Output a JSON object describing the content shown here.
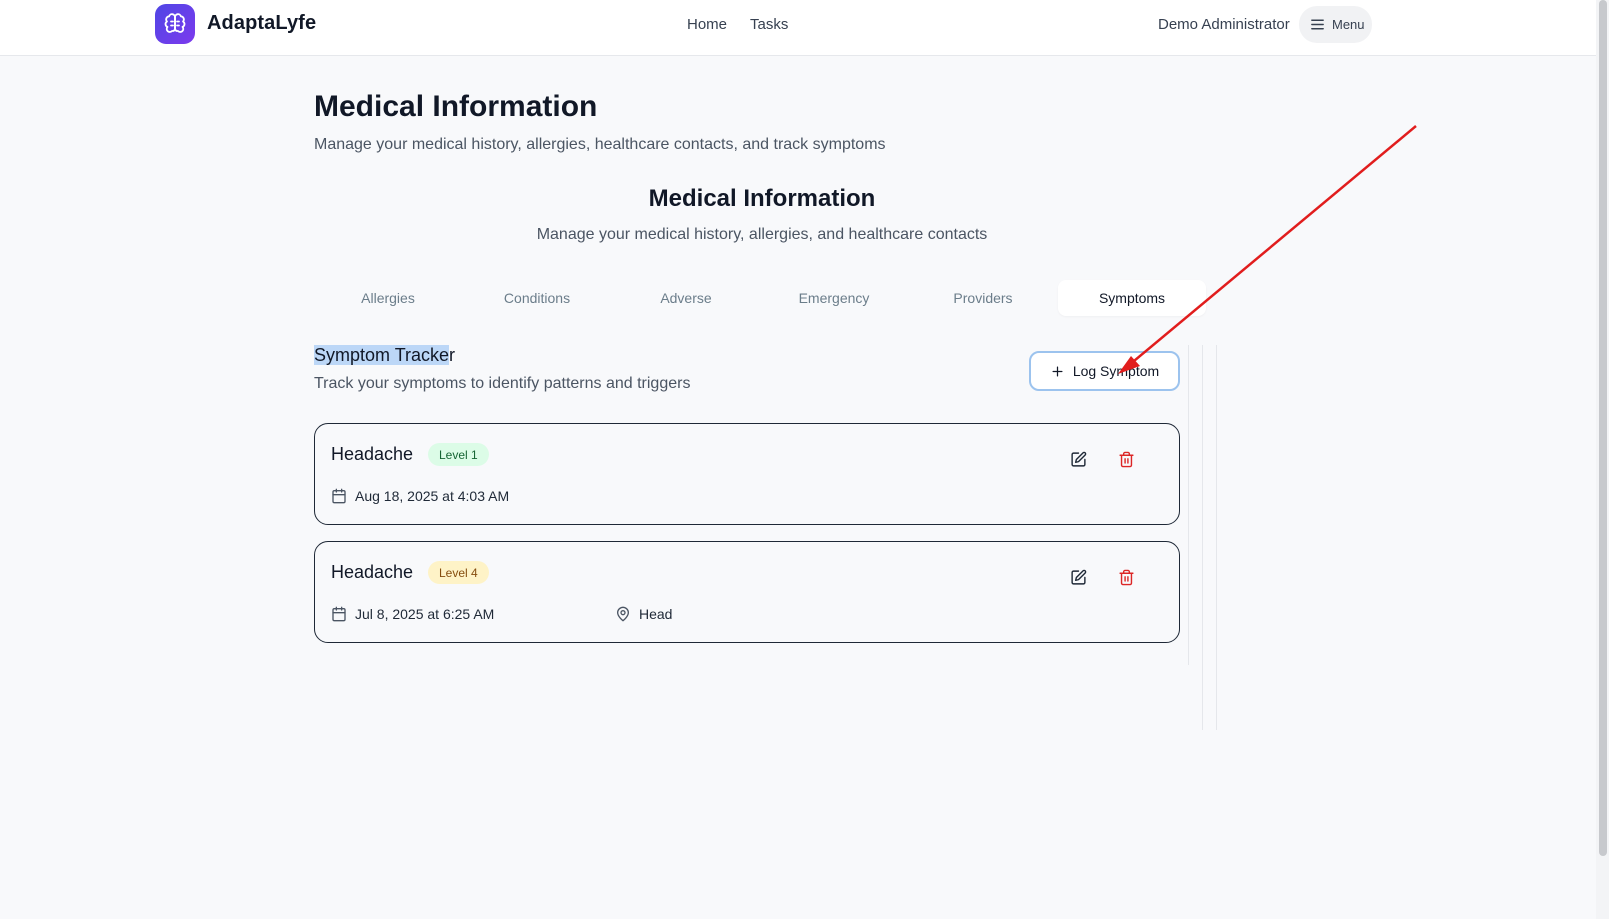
{
  "header": {
    "brand": "AdaptaLyfe",
    "nav": {
      "home": "Home",
      "tasks": "Tasks"
    },
    "user": "Demo Administrator",
    "menu_label": "Menu"
  },
  "page": {
    "title": "Medical Information",
    "subtitle": "Manage your medical history, allergies, healthcare contacts, and track symptoms"
  },
  "section": {
    "title": "Medical Information",
    "subtitle": "Manage your medical history, allergies, and healthcare contacts"
  },
  "tabs": [
    {
      "label": "Allergies"
    },
    {
      "label": "Conditions"
    },
    {
      "label": "Adverse"
    },
    {
      "label": "Emergency"
    },
    {
      "label": "Providers"
    },
    {
      "label": "Symptoms",
      "active": true
    }
  ],
  "tracker": {
    "title_highlighted": "Symptom Tracke",
    "title_rest": "r",
    "subtitle": "Track your symptoms to identify patterns and triggers",
    "log_button": "Log Symptom"
  },
  "symptoms": [
    {
      "name": "Headache",
      "level": "Level 1",
      "level_color": "#dcfce7",
      "date": "Aug 18, 2025 at 4:03 AM",
      "location": ""
    },
    {
      "name": "Headache",
      "level": "Level 4",
      "level_color": "#fef3c7",
      "date": "Jul 8, 2025 at 6:25 AM",
      "location": "Head"
    }
  ],
  "colors": {
    "accent_gradient_start": "#4f46e5",
    "accent_gradient_end": "#7c3aed",
    "delete_red": "#dc2626",
    "annotation_arrow": "#e11d1d"
  },
  "icons": {
    "logo": "brain-icon",
    "menu": "hamburger-icon",
    "add": "plus-icon",
    "edit": "edit-icon",
    "delete": "trash-icon",
    "date": "calendar-icon",
    "location": "map-pin-icon"
  }
}
